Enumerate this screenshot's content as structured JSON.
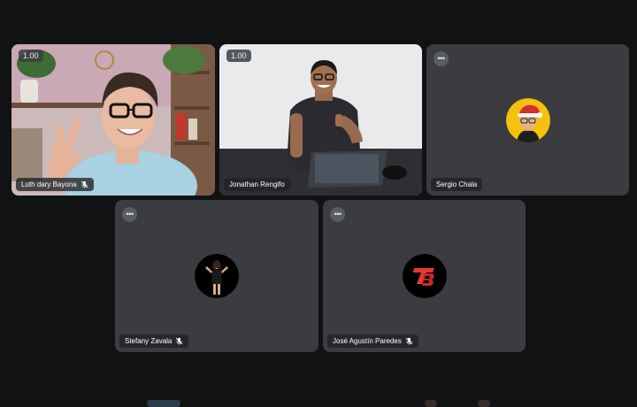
{
  "participants": [
    {
      "name": "Luth dary Bayona",
      "muted": true,
      "level": "1.00"
    },
    {
      "name": "Jonathan Rengifo",
      "muted": false,
      "level": "1.00"
    },
    {
      "name": "Sergio Chala",
      "muted": false
    },
    {
      "name": "Stefany Zavala",
      "muted": true
    },
    {
      "name": "José Agustín Paredes",
      "muted": true
    }
  ],
  "more_options_glyph": "•••",
  "colors": {
    "background": "#111214",
    "tile": "#3b3c3f",
    "name_tag": "#202124",
    "avatar_yellow": "#f4c20d",
    "avatar_black": "#000000",
    "logo_red": "#e53935"
  }
}
